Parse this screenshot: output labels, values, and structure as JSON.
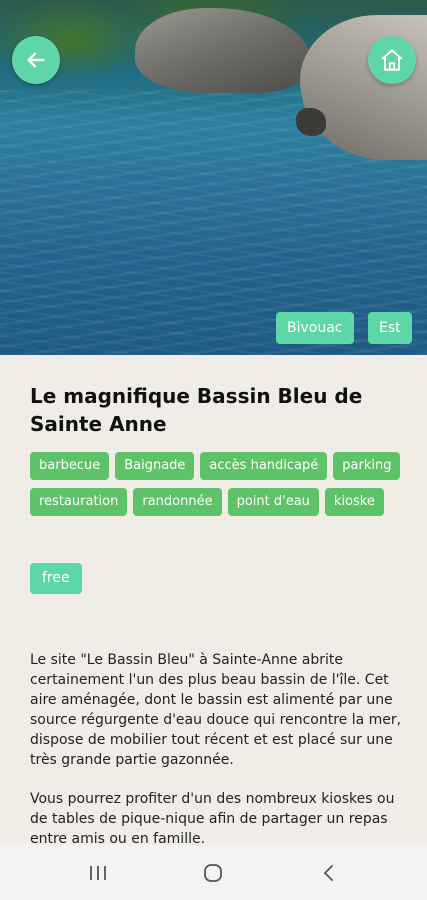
{
  "hero": {
    "image_alt": "Bassin Bleu water pool with rocks",
    "chips": [
      "Bivouac",
      "Est"
    ]
  },
  "buttons": {
    "back_icon": "arrow-left-icon",
    "home_icon": "home-icon"
  },
  "title": "Le magnifique Bassin Bleu de Sainte Anne",
  "tags": {
    "row1": [
      "barbecue",
      "Baignade",
      "accès handicapé",
      "parking"
    ],
    "row2": [
      "restauration",
      "randonnée",
      "point d'eau",
      "kioske"
    ]
  },
  "price": "free",
  "description": [
    "Le site \"Le Bassin Bleu\" à Sainte-Anne abrite certainement l'un des plus beau bassin de l'île. Cet aire aménagée, dont le bassin est alimenté par une source régurgente d'eau douce qui rencontre la mer, dispose de mobilier tout récent et est placé sur une très grande partie gazonnée.",
    "Vous pourrez profiter d'un des nombreux kioskes ou de tables de pique-nique afin de partager un repas entre amis ou en famille."
  ],
  "colors": {
    "accent": "#5ed6a8",
    "tag_green": "#5ec268",
    "background": "#efede6"
  },
  "nav": {
    "recent_icon": "recent-apps-icon",
    "home_icon": "circle-home-icon",
    "back_icon": "chevron-left-icon"
  }
}
